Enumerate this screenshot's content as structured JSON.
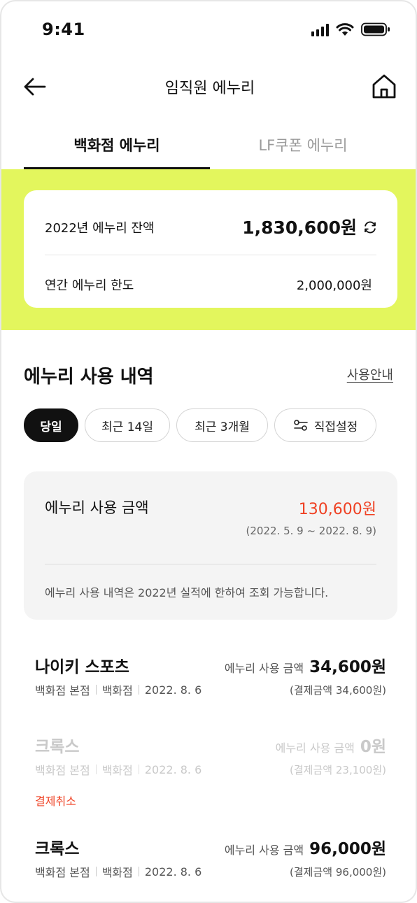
{
  "status": {
    "time": "9:41"
  },
  "header": {
    "title": "임직원 에누리"
  },
  "tabs": [
    {
      "label": "백화점 에누리",
      "active": true
    },
    {
      "label": "LF쿠폰 에누리",
      "active": false
    }
  ],
  "balance": {
    "label": "2022년 에누리 잔액",
    "value": "1,830,600원",
    "limit_label": "연간 에누리 한도",
    "limit_value": "2,000,000원"
  },
  "section": {
    "title": "에누리 사용 내역",
    "guide_link": "사용안내"
  },
  "filters": [
    {
      "label": "당일",
      "active": true
    },
    {
      "label": "최근 14일",
      "active": false
    },
    {
      "label": "최근 3개월",
      "active": false
    },
    {
      "label": "직접설정",
      "active": false
    }
  ],
  "summary": {
    "label": "에누리 사용 금액",
    "value": "130,600원",
    "range": "(2022. 5.  9 ~ 2022. 8. 9)",
    "note": "에누리 사용 내역은 2022년 실적에 한하여 조회 가능합니다."
  },
  "transactions": [
    {
      "name": "나이키 스포츠",
      "store": "백화점 본점",
      "type": "백화점",
      "date": "2022. 8. 6",
      "amount_label": "에누리 사용 금액",
      "amount": "34,600원",
      "paid": "(결제금액 34,600원)",
      "cancelled": false
    },
    {
      "name": "크록스",
      "store": "백화점 본점",
      "type": "백화점",
      "date": "2022. 8. 6",
      "amount_label": "에누리 사용 금액",
      "amount": "0원",
      "paid": "(결제금액 23,100원)",
      "cancelled": true,
      "status": "결제취소"
    },
    {
      "name": "크록스",
      "store": "백화점 본점",
      "type": "백화점",
      "date": "2022. 8. 6",
      "amount_label": "에누리 사용 금액",
      "amount": "96,000원",
      "paid": "(결제금액 96,000원)",
      "cancelled": false
    }
  ],
  "colors": {
    "accent_band": "#e3f65d",
    "highlight_red": "#ef4123",
    "text": "#111111"
  },
  "icons": [
    "signal-icon",
    "wifi-icon",
    "battery-icon",
    "back-arrow-icon",
    "home-icon",
    "refresh-icon",
    "filter-settings-icon"
  ]
}
